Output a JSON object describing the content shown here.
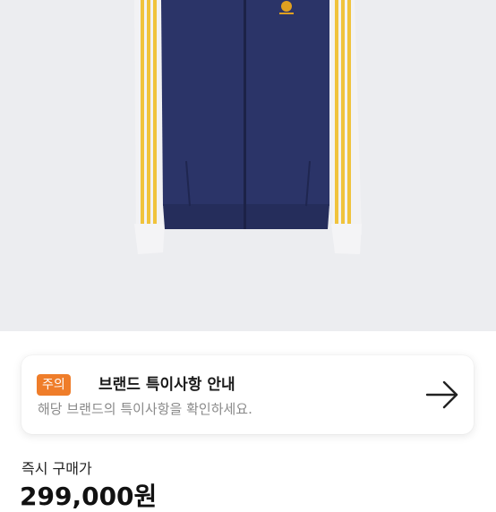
{
  "product": {
    "image_alt_icon": "track-jacket-image",
    "colors": {
      "body": "#2b3468",
      "stripe": "#f0c33c",
      "sleeve": "#f2f2f4",
      "logo": "#e0a020"
    }
  },
  "notice": {
    "badge": "주의",
    "title": "브랜드 특이사항 안내",
    "description": "해당 브랜드의 특이사항을 확인하세요.",
    "icon": "arrow-right-icon",
    "badge_color": "#ef7d2a"
  },
  "purchase": {
    "label": "즉시 구매가",
    "price": "299,000원"
  }
}
